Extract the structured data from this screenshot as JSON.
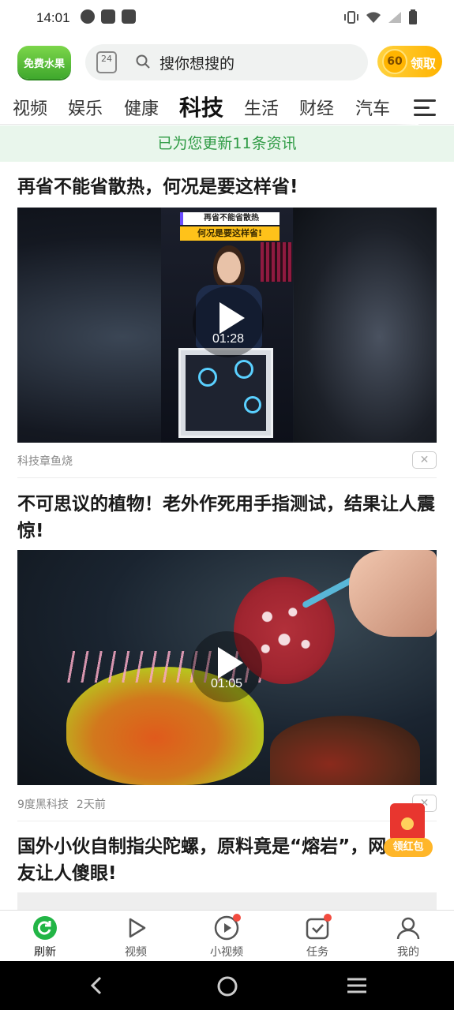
{
  "status_bar": {
    "time": "14:01"
  },
  "header": {
    "logo_text": "免费水果",
    "calendar_day": "24",
    "search_placeholder": "搜你想搜的",
    "coin_value": "60",
    "coin_label": "领取"
  },
  "tabs": [
    "视频",
    "娱乐",
    "健康",
    "科技",
    "生活",
    "财经",
    "汽车"
  ],
  "active_tab": "科技",
  "banner": "已为您更新11条资讯",
  "feed": [
    {
      "title": "再省不能省散热，何况是要这样省!",
      "duration": "01:28",
      "overlay_line1": "再省不能省散热",
      "overlay_line2": "何况是要这样省!",
      "source": "科技章鱼烧",
      "time": ""
    },
    {
      "title": "不可思议的植物！老外作死用手指测试，结果让人震惊!",
      "duration": "01:05",
      "source": "9度黑科技",
      "time": "2天前"
    },
    {
      "title": "国外小伙自制指尖陀螺，原料竟是“熔岩”，网友让人傻眼!"
    }
  ],
  "floating": {
    "red_packet_label": "领红包"
  },
  "bottom_nav": [
    {
      "label": "刷新",
      "icon": "refresh-icon"
    },
    {
      "label": "视频",
      "icon": "video-play-icon"
    },
    {
      "label": "小视频",
      "icon": "short-video-icon"
    },
    {
      "label": "任务",
      "icon": "task-icon"
    },
    {
      "label": "我的",
      "icon": "profile-icon"
    }
  ],
  "colors": {
    "brand_green": "#3fa82d",
    "banner_text": "#2f9b45",
    "badge_red": "#f24b3f",
    "coin_gold": "#ffb300"
  }
}
